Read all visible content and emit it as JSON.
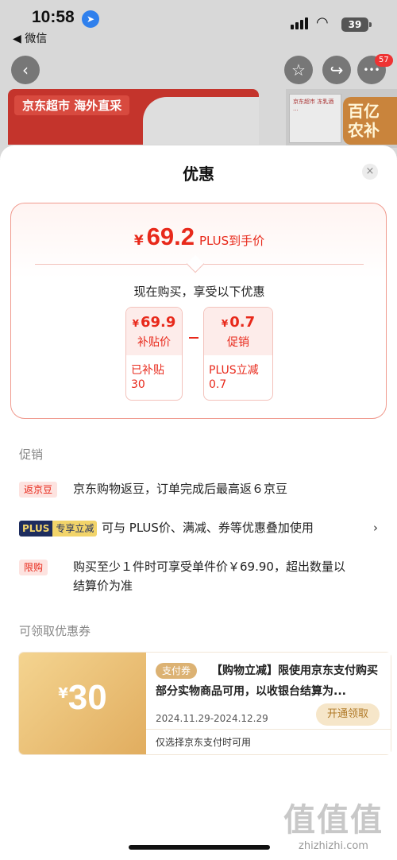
{
  "status_bar": {
    "time": "10:58",
    "back_app": "◀ 微信",
    "battery": "39"
  },
  "nav": {
    "back_icon": "‹",
    "star_icon": "☆",
    "share_icon": "↪",
    "more_icon": "•••",
    "badge": "57"
  },
  "background": {
    "banner_text": "京东超市 海外直采",
    "product_snippet": "京东超市 冻乳酒 ...",
    "promo_tag": "百亿农补"
  },
  "sheet": {
    "title": "优惠",
    "close_icon": "×",
    "summary": {
      "currency": "¥",
      "final_price": "69.2",
      "final_label": "PLUS到手价",
      "now_buy": "现在购买，享受以下优惠",
      "chip_a": {
        "currency": "¥",
        "value": "69.9",
        "label": "补贴价",
        "note_line1": "已补贴",
        "note_line2": "30"
      },
      "chip_b": {
        "currency": "¥",
        "value": "0.7",
        "label": "促销",
        "note_line1": "PLUS立减",
        "note_line2": "0.7"
      }
    },
    "promo_section_label": "促销",
    "promos": [
      {
        "tag": "返京豆",
        "text": "京东购物返豆，订单完成后最高返６京豆"
      },
      {
        "tag_plus": "PLUS",
        "tag_plus2": "专享立减",
        "text": "可与 PLUS价、满减、券等优惠叠加使用",
        "chevron": "›"
      },
      {
        "tag": "限购",
        "text_line1": "购买至少１件时可享受单件价￥69.90，超出数量以",
        "text_line2": "结算价为准"
      }
    ],
    "coupon_section_label": "可领取优惠券",
    "coupon": {
      "currency": "¥",
      "amount": "30",
      "type_tag": "支付券",
      "description": "【购物立减】限使用京东支付购买部分实物商品可用，以收银台结算为...",
      "date_range": "2024.11.29-2024.12.29",
      "button": "开通领取",
      "note": "仅选择京东支付时可用"
    }
  },
  "watermark": {
    "line1": "值值值",
    "line2": "zhizhizhi.com"
  }
}
